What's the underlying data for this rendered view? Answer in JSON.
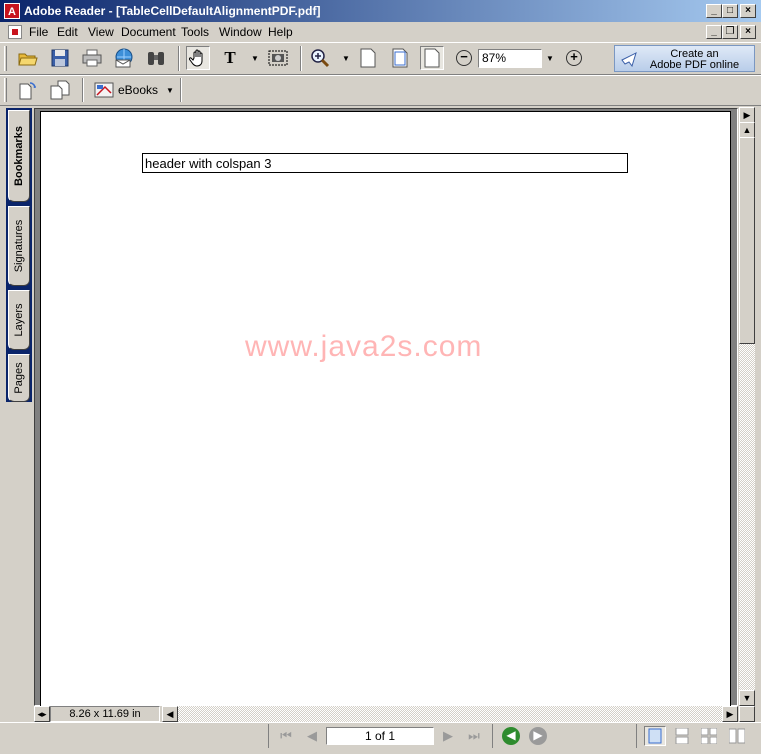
{
  "window": {
    "title": "Adobe Reader - [TableCellDefaultAlignmentPDF.pdf]",
    "app_icon_letter": "A",
    "caption_buttons": {
      "minimize": "_",
      "maximize": "□",
      "close": "×"
    }
  },
  "menubar": {
    "items": [
      "File",
      "Edit",
      "View",
      "Document",
      "Tools",
      "Window",
      "Help"
    ],
    "mdi_buttons": {
      "minimize": "_",
      "restore": "❐",
      "close": "×"
    }
  },
  "toolbar": {
    "zoom_value": "87%",
    "create_pdf": {
      "line1": "Create an",
      "line2": "Adobe PDF online"
    },
    "ebooks_label": "eBooks",
    "select_text_glyph": "T"
  },
  "nav_tabs": [
    "Bookmarks",
    "Signatures",
    "Layers",
    "Pages"
  ],
  "document": {
    "table_header_cell": "header with colspan 3",
    "watermark": "www.java2s.com",
    "page_size": "8.26 x 11.69 in"
  },
  "status": {
    "page_indicator": "1 of 1"
  },
  "colors": {
    "titlebar_start": "#0a246a",
    "titlebar_end": "#a6caf0",
    "watermark": "#ffb5b5",
    "back_button": "#2e8b2e",
    "forward_button": "#9a9a9a"
  }
}
